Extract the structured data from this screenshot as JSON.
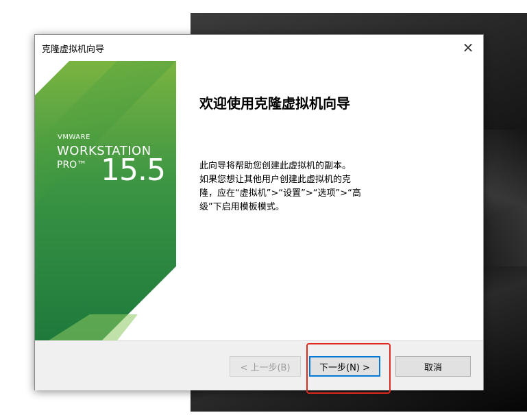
{
  "window": {
    "title": "克隆虚拟机向导",
    "close_icon": "×"
  },
  "banner": {
    "vendor": "VMWARE",
    "product": "WORKSTATION",
    "edition": "PRO™",
    "version": "15.5",
    "colors": {
      "light_green": "#7ab441",
      "dark_green": "#1e7a3c"
    }
  },
  "content": {
    "heading": "欢迎使用克隆虚拟机向导",
    "description_lines": [
      "此向导将帮助您创建此虚拟机的副本。",
      "如果您想让其他用户创建此虚拟机的克",
      "隆，应在“虚拟机”>“设置”>“选项”>“高",
      "级”下启用模板模式。"
    ]
  },
  "buttons": {
    "back": "< 上一步(B)",
    "next": "下一步(N) >",
    "cancel": "取消"
  },
  "annotation": {
    "color": "#e0281e"
  }
}
